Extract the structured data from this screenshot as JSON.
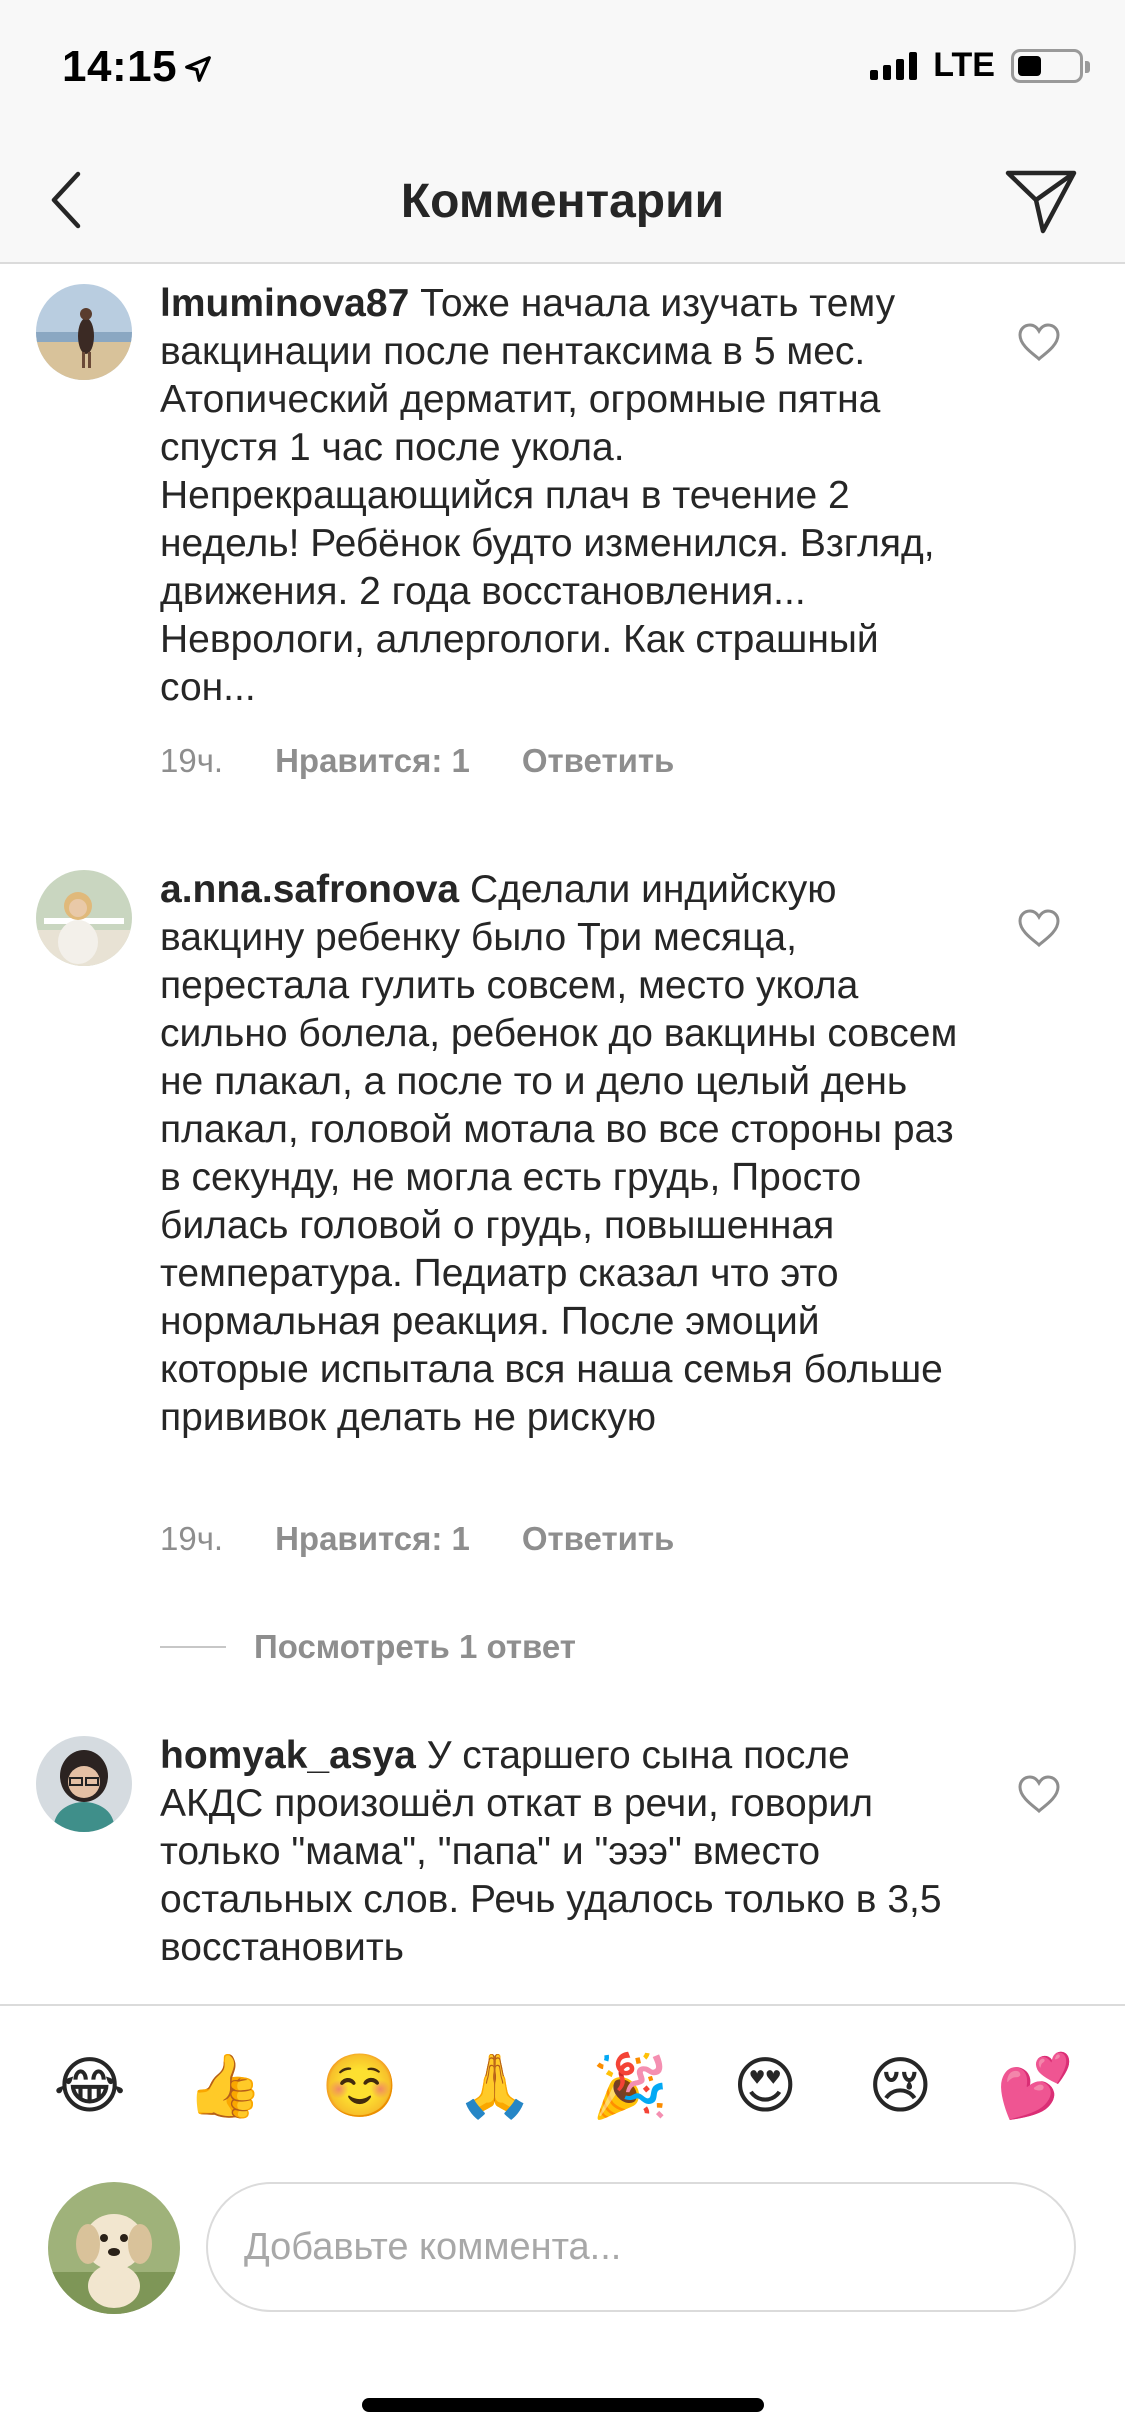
{
  "status_bar": {
    "time": "14:15",
    "network": "LTE",
    "battery_level": 0.4
  },
  "header": {
    "title": "Комментарии",
    "back_icon": "chevron-left-icon",
    "send_icon": "paper-plane-icon"
  },
  "comments": [
    {
      "username": "lmuminova87",
      "text": "Тоже начала изучать тему вакцинации после пентаксима в 5 мес. Атопический дерматит, огромные пятна спустя 1 час после укола. Непрекращающийся плач в течение 2 недель! Ребёнок будто изменился. Взгляд, движения. 2 года восстановления... Неврологи, аллергологи. Как страшный сон...",
      "time": "19ч.",
      "likes": "Нравится: 1",
      "reply": "Ответить"
    },
    {
      "username": "a.nna.safronova",
      "text": "Сделали индийскую вакцину ребенку было Три месяца, перестала гулить совсем, место укола сильно болела, ребенок до вакцины совсем не плакал, а после то и дело целый день плакал, головой мотала во все стороны раз в секунду, не могла есть грудь, Просто билась головой о грудь, повышенная температура. Педиатр сказал что это нормальная реакция. После эмоций которые испытала вся наша семья больше прививок делать не рискую",
      "time": "19ч.",
      "likes": "Нравится: 1",
      "reply": "Ответить",
      "view_replies": "Посмотреть 1 ответ"
    },
    {
      "username": "homyak_asya",
      "text": "У старшего сына после АКДС произошёл откат в речи, говорил только \"мама\", \"папа\" и \"эээ\" вместо остальных слов. Речь удалось только в 3,5 восстановить"
    }
  ],
  "emoji_bar": [
    "😂",
    "👍",
    "☺️",
    "🙏",
    "🎉",
    "😍",
    "😢",
    "💕"
  ],
  "composer": {
    "placeholder": "Добавьте коммента..."
  },
  "colors": {
    "text": "#262626",
    "secondary": "#8e8e8e",
    "border": "#dbdbdb",
    "bar_bg": "#f8f8f8"
  }
}
